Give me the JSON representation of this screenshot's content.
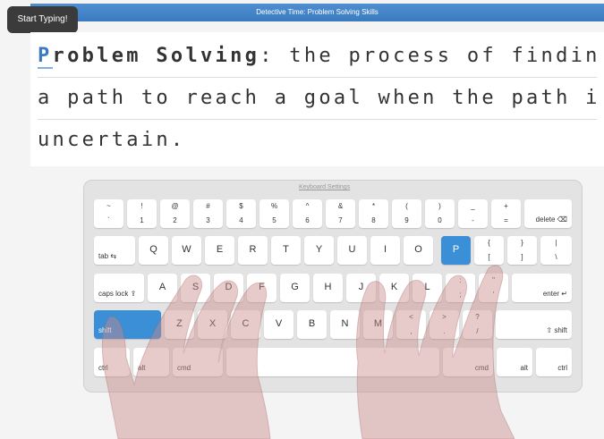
{
  "app": {
    "title": "Detective Time: Problem Solving Skills",
    "tooltip": "Start Typing!"
  },
  "text": {
    "current_char": "P",
    "line1_rest_bold": "roblem Solving",
    "line1_tail": ": the process of finding",
    "line2": "a path to reach a goal when the path is",
    "line3": "uncertain."
  },
  "keyboard": {
    "settings_link": "Keyboard Settings",
    "highlight_color": "#3a8fd6",
    "row1": [
      {
        "top": "~",
        "bottom": "`"
      },
      {
        "top": "!",
        "bottom": "1"
      },
      {
        "top": "@",
        "bottom": "2"
      },
      {
        "top": "#",
        "bottom": "3"
      },
      {
        "top": "$",
        "bottom": "4"
      },
      {
        "top": "%",
        "bottom": "5"
      },
      {
        "top": "^",
        "bottom": "6"
      },
      {
        "top": "&",
        "bottom": "7"
      },
      {
        "top": "*",
        "bottom": "8"
      },
      {
        "top": "(",
        "bottom": "9"
      },
      {
        "top": ")",
        "bottom": "0"
      },
      {
        "top": "_",
        "bottom": "-"
      },
      {
        "top": "+",
        "bottom": "="
      }
    ],
    "delete": "delete ⌫",
    "tab": "tab ⇆",
    "row2": [
      "Q",
      "W",
      "E",
      "R",
      "T",
      "Y",
      "U",
      "I",
      "O",
      "P"
    ],
    "row2_extra": [
      {
        "top": "{",
        "bottom": "["
      },
      {
        "top": "}",
        "bottom": "]"
      },
      {
        "top": "|",
        "bottom": "\\"
      }
    ],
    "caps": "caps lock ⇪",
    "row3": [
      "A",
      "S",
      "D",
      "F",
      "G",
      "H",
      "J",
      "K",
      "L"
    ],
    "row3_extra": [
      {
        "top": ":",
        "bottom": ";"
      },
      {
        "top": "\"",
        "bottom": "'"
      }
    ],
    "enter": "enter ↵",
    "shift_left": "shift",
    "row4": [
      "Z",
      "X",
      "C",
      "V",
      "B",
      "N",
      "M"
    ],
    "row4_extra": [
      {
        "top": "<",
        "bottom": ","
      },
      {
        "top": ">",
        "bottom": "."
      },
      {
        "top": "?",
        "bottom": "/"
      }
    ],
    "shift_right": "⇧ shift",
    "ctrl_left": "ctrl",
    "alt_left": "alt",
    "cmd_left": "cmd",
    "cmd_right": "cmd",
    "alt_right": "alt",
    "ctrl_right": "ctrl"
  }
}
